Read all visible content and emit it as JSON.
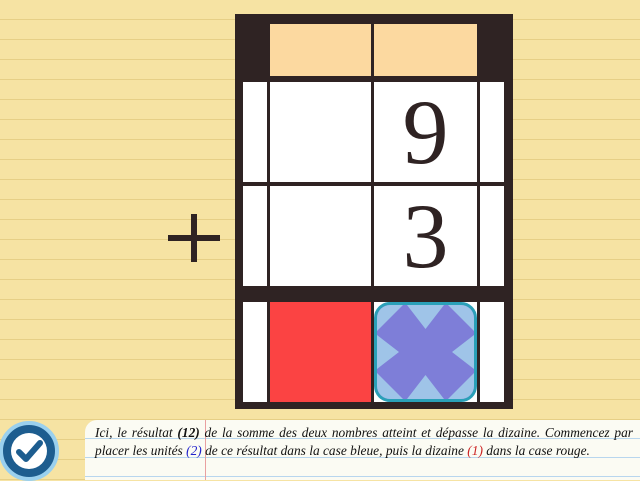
{
  "operation": {
    "operator": "+",
    "carry_row": [
      "",
      ""
    ],
    "addend1": {
      "tens": "",
      "units": "9"
    },
    "addend2": {
      "tens": "",
      "units": "3"
    },
    "result_boxes": {
      "tens_color": "#fb4343",
      "units_color": "#7e7ed8"
    }
  },
  "instruction": {
    "part1": "Ici, le résultat ",
    "result": "(12)",
    "part2": " de la somme des deux nombres atteint et dépasse la dizaine. Commencez par placer les unités ",
    "units": "(2)",
    "part3": " de ce résultat dans la case bleue, puis la dizaine ",
    "tens": "(1)",
    "part4": " dans la case rouge."
  },
  "icons": {
    "validate": "checkmark-icon",
    "units_box": "x-cross-icon",
    "operator": "plus-icon"
  },
  "colors": {
    "background": "#f6e3a3",
    "board": "#2f2323",
    "carry": "#fcd9a0",
    "red": "#fb4343",
    "blue": "#7e7ed8",
    "button": "#1d5d8f"
  }
}
